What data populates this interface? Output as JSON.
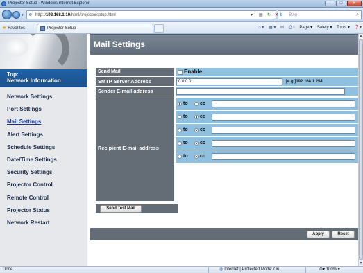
{
  "window": {
    "title": "Projector Setup - Windows Internet Explorer",
    "buttons": {
      "minimize": "–",
      "maximize": "□",
      "close": "✕"
    }
  },
  "browser": {
    "url_prefix": "http://",
    "url_host": "192.168.1.10",
    "url_path": "/html/projectorsetup.html",
    "search_placeholder": "Bing",
    "favorites_label": "Favorites",
    "tab_title": "Projector Setup",
    "tools": {
      "page": "Page ▾",
      "safety": "Safety ▾",
      "tools": "Tools ▾"
    }
  },
  "sidebar": {
    "top_line1": "Top:",
    "top_line2": "Network Information",
    "items": [
      {
        "label": "Network Settings"
      },
      {
        "label": "Port Settings"
      },
      {
        "label": "Mail Settings",
        "active": true
      },
      {
        "label": "Alert Settings"
      },
      {
        "label": "Schedule Settings"
      },
      {
        "label": "Date/Time Settings"
      },
      {
        "label": "Security Settings"
      },
      {
        "label": "Projector Control"
      },
      {
        "label": "Remote Control"
      },
      {
        "label": "Projector Status"
      },
      {
        "label": "Network Restart"
      }
    ]
  },
  "main": {
    "title": "Mail Settings",
    "send_mail": {
      "label": "Send Mail",
      "option": "Enable",
      "checked": false
    },
    "smtp": {
      "label": "SMTP Server Address",
      "value": "0.0.0.0",
      "hint": "[e.g.]192.168.1.254"
    },
    "sender": {
      "label": "Sender E-mail address",
      "value": ""
    },
    "recipient": {
      "label": "Recipient E-mail address",
      "to_label": "to",
      "cc_label": "cc",
      "rows": [
        {
          "mode": "to",
          "value": ""
        },
        {
          "mode": "cc",
          "value": ""
        },
        {
          "mode": "cc",
          "value": ""
        },
        {
          "mode": "cc",
          "value": ""
        },
        {
          "mode": "cc",
          "value": ""
        }
      ]
    },
    "send_test_mail": "Send Test Mail",
    "apply": "Apply",
    "reset": "Reset"
  },
  "statusbar": {
    "left": "Done",
    "zone": "Internet | Protected Mode: On",
    "zoom": "100%"
  }
}
